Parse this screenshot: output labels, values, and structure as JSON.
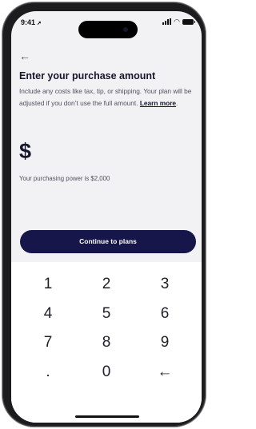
{
  "status_bar": {
    "time": "9:41",
    "location_icon": "location-arrow-icon",
    "signal_icon": "cellular-signal-icon",
    "wifi_icon": "wifi-icon",
    "battery_icon": "battery-icon"
  },
  "header": {
    "back_icon": "←"
  },
  "purchase": {
    "title": "Enter your purchase amount",
    "description": "Include any costs like tax, tip, or shipping. Your plan will be adjusted if you don’t use the full amount.",
    "learn_more": "Learn more",
    "learn_more_suffix": ".",
    "currency_symbol": "$",
    "purchasing_power": "Your purchasing power is $2,000"
  },
  "cta": {
    "label": "Continue to plans"
  },
  "keypad": {
    "keys": [
      "1",
      "2",
      "3",
      "4",
      "5",
      "6",
      "7",
      "8",
      "9",
      ".",
      "0",
      "←"
    ]
  },
  "colors": {
    "primary": "#17164a",
    "background": "#f2f2f4",
    "text": "#17172b"
  }
}
